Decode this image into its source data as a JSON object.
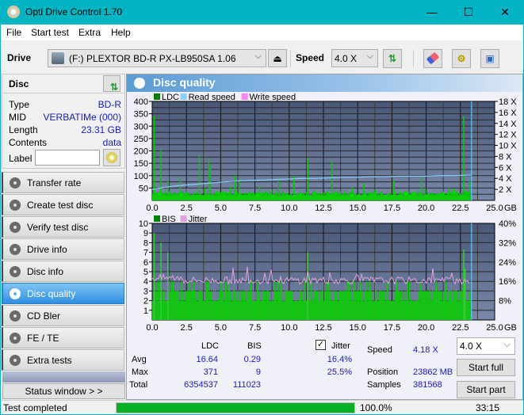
{
  "window": {
    "title": "Opti Drive Control 1.70",
    "minimize": "—",
    "maximize": "☐",
    "close": "✕"
  },
  "menu": [
    "File",
    "Start test",
    "Extra",
    "Help"
  ],
  "toolbar": {
    "drive_label": "Drive",
    "drive_value": "(F:)  PLEXTOR BD-R  PX-LB950SA 1.06",
    "speed_label": "Speed",
    "speed_value": "4.0 X"
  },
  "disc": {
    "header": "Disc",
    "type_label": "Type",
    "type_value": "BD-R",
    "mid_label": "MID",
    "mid_value": "VERBATIMe (000)",
    "length_label": "Length",
    "length_value": "23.31 GB",
    "contents_label": "Contents",
    "contents_value": "data",
    "label_label": "Label",
    "label_value": ""
  },
  "nav": [
    {
      "label": "Transfer rate"
    },
    {
      "label": "Create test disc"
    },
    {
      "label": "Verify test disc"
    },
    {
      "label": "Drive info"
    },
    {
      "label": "Disc info"
    },
    {
      "label": "Disc quality",
      "active": true
    },
    {
      "label": "CD Bler"
    },
    {
      "label": "FE / TE"
    },
    {
      "label": "Extra tests"
    }
  ],
  "status_window_button": "Status window > >",
  "panel": {
    "title": "Disc quality"
  },
  "chart_data": [
    {
      "type": "bar",
      "title": "LDC",
      "legend": [
        "LDC",
        "Read speed",
        "Write speed"
      ],
      "legend_colors": [
        "#008000",
        "#87cefa",
        "#ff80ff"
      ],
      "xlabel": "GB",
      "x_ticks": [
        "0.0",
        "2.5",
        "5.0",
        "7.5",
        "10.0",
        "12.5",
        "15.0",
        "17.5",
        "20.0",
        "22.5",
        "25.0"
      ],
      "xlim": [
        0,
        25
      ],
      "ylim": [
        0,
        400
      ],
      "y_ticks": [
        "400",
        "350",
        "300",
        "250",
        "200",
        "150",
        "100",
        "50"
      ],
      "y2_ticks": [
        "18 X",
        "16 X",
        "14 X",
        "12 X",
        "10 X",
        "8 X",
        "6 X",
        "4 X",
        "2 X"
      ],
      "y2lim": [
        0,
        18
      ],
      "ldc_baseline": 20,
      "ldc_spikes": [
        [
          0.1,
          340
        ],
        [
          0.6,
          205
        ],
        [
          1.1,
          80
        ],
        [
          2.0,
          90
        ],
        [
          3.4,
          185
        ],
        [
          4.1,
          170
        ],
        [
          4.2,
          140
        ],
        [
          6.0,
          100
        ],
        [
          6.3,
          85
        ],
        [
          7.8,
          60
        ],
        [
          9.2,
          90
        ],
        [
          10.3,
          100
        ],
        [
          11.3,
          170
        ],
        [
          13.1,
          160
        ],
        [
          15.4,
          70
        ],
        [
          17.6,
          80
        ],
        [
          19.6,
          100
        ],
        [
          21.6,
          50
        ],
        [
          22.7,
          340
        ],
        [
          23.1,
          75
        ]
      ],
      "read_speed": [
        [
          0,
          2.0
        ],
        [
          1,
          2.4
        ],
        [
          2,
          2.7
        ],
        [
          3,
          2.9
        ],
        [
          4,
          3.1
        ],
        [
          5,
          3.3
        ],
        [
          6,
          3.5
        ],
        [
          7,
          3.6
        ],
        [
          8,
          3.7
        ],
        [
          9,
          3.8
        ],
        [
          10,
          3.9
        ],
        [
          11,
          4.0
        ],
        [
          12,
          4.0
        ],
        [
          13,
          4.1
        ],
        [
          14,
          4.2
        ],
        [
          15,
          4.2
        ],
        [
          16,
          4.3
        ],
        [
          17,
          4.3
        ],
        [
          18,
          4.4
        ],
        [
          19,
          4.4
        ],
        [
          20,
          4.4
        ],
        [
          21,
          4.5
        ],
        [
          22,
          4.5
        ],
        [
          23.3,
          4.6
        ]
      ],
      "end_marker": 23.31
    },
    {
      "type": "bar",
      "title": "BIS",
      "legend": [
        "BIS",
        "Jitter"
      ],
      "legend_colors": [
        "#008000",
        "#e0a0e0"
      ],
      "xlabel": "GB",
      "x_ticks": [
        "0.0",
        "2.5",
        "5.0",
        "7.5",
        "10.0",
        "12.5",
        "15.0",
        "17.5",
        "20.0",
        "22.5",
        "25.0"
      ],
      "xlim": [
        0,
        25
      ],
      "ylim": [
        0,
        10
      ],
      "y_ticks": [
        "10",
        "9",
        "8",
        "7",
        "6",
        "5",
        "4",
        "3",
        "2",
        "1"
      ],
      "y2_ticks": [
        "40%",
        "32%",
        "24%",
        "16%",
        "8%"
      ],
      "y2lim": [
        0,
        40
      ],
      "bis_spikes": [
        [
          0.1,
          9
        ],
        [
          0.6,
          8
        ],
        [
          1.1,
          7
        ],
        [
          11.3,
          7
        ],
        [
          22.7,
          7.3
        ],
        [
          22.8,
          5.3
        ]
      ],
      "jitter_avg_pct": 16.4,
      "end_marker": 23.31
    }
  ],
  "stats": {
    "col_ldc": "LDC",
    "col_bis": "BIS",
    "jitter_label": "Jitter",
    "jitter_checked": true,
    "avg_label": "Avg",
    "avg_ldc": "16.64",
    "avg_bis": "0.29",
    "avg_jitter": "16.4%",
    "max_label": "Max",
    "max_ldc": "371",
    "max_bis": "9",
    "max_jitter": "25.5%",
    "total_label": "Total",
    "total_ldc": "6354537",
    "total_bis": "111023",
    "speed_label": "Speed",
    "speed_value": "4.18 X",
    "position_label": "Position",
    "position_value": "23862 MB",
    "samples_label": "Samples",
    "samples_value": "381568",
    "speed_select": "4.0 X",
    "start_full": "Start full",
    "start_part": "Start part"
  },
  "statusbar": {
    "text": "Test completed",
    "progress_pct": 100,
    "progress_label": "100.0%",
    "time": "33:15"
  }
}
